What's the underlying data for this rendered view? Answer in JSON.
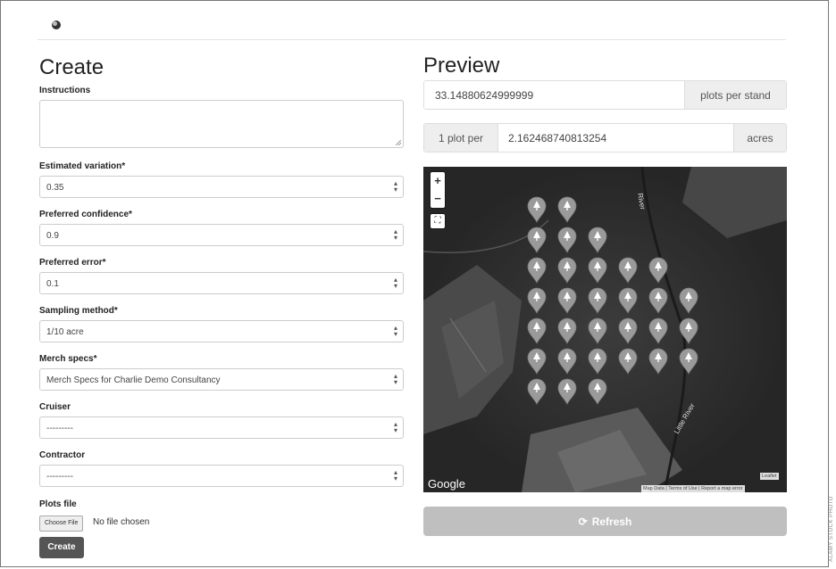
{
  "header": {
    "logo": "globe-icon"
  },
  "left": {
    "title": "Create",
    "instructions": {
      "label": "Instructions",
      "value": ""
    },
    "fields": [
      {
        "label": "Estimated variation*",
        "value": "0.35"
      },
      {
        "label": "Preferred confidence*",
        "value": "0.9"
      },
      {
        "label": "Preferred error*",
        "value": "0.1"
      },
      {
        "label": "Sampling method*",
        "value": "1/10 acre"
      },
      {
        "label": "Merch specs*",
        "value": "Merch Specs for Charlie Demo Consultancy"
      },
      {
        "label": "Cruiser",
        "value": "---------"
      },
      {
        "label": "Contractor",
        "value": "---------"
      }
    ],
    "plots_file": {
      "label": "Plots file",
      "button": "Choose File",
      "status": "No file chosen"
    },
    "create_button": "Create"
  },
  "preview": {
    "title": "Preview",
    "plots_value": "33.14880624999999",
    "plots_unit": "plots per stand",
    "plot_per_label": "1 plot per",
    "acres_value": "2.162468740813254",
    "acres_unit": "acres",
    "map": {
      "zoom_in": "+",
      "zoom_out": "−",
      "river_label_1": "River",
      "river_label_2": "Little River",
      "google": "Google",
      "leaflet": "Leaflet",
      "attribution": "Map Data | Terms of Use | Report a map error",
      "marker_icon": "tree-marker-icon",
      "marker_count": 31
    },
    "refresh_button": "Refresh"
  },
  "side_caption": "ALAMY STOCK PHOTO"
}
